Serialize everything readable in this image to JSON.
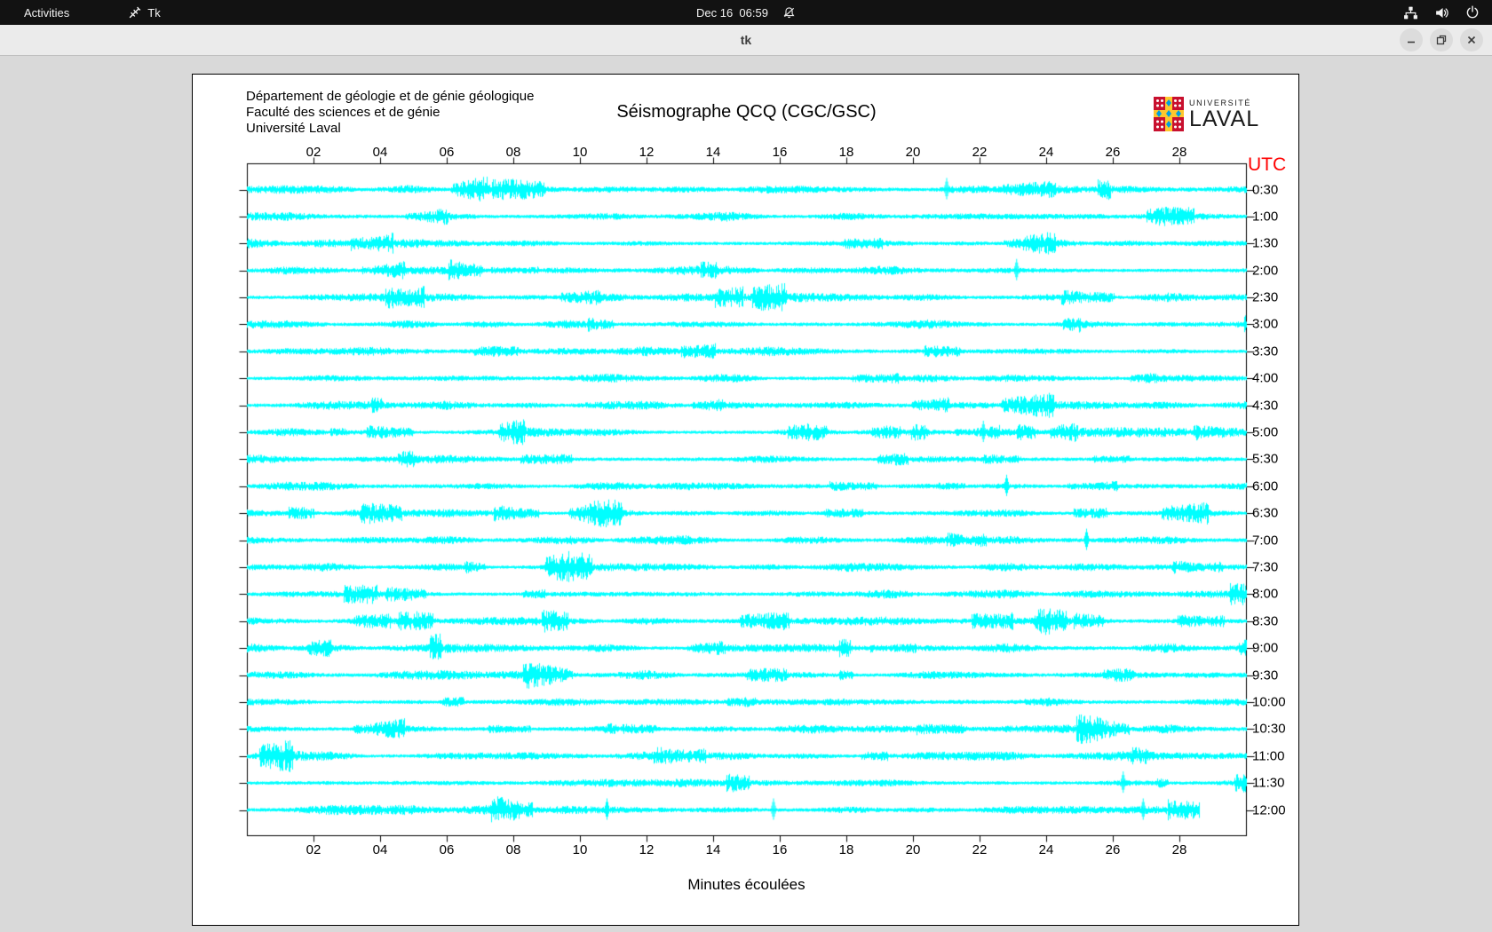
{
  "top_bar": {
    "activities": "Activities",
    "app_indicator": "Tk",
    "clock": "Dec 16  06:59"
  },
  "titlebar": {
    "title": "tk"
  },
  "document": {
    "header_lines": "Département de géologie et de génie géologique\nFaculté des sciences et de génie\nUniversité Laval",
    "logo_top": "UNIVERSITÉ",
    "logo_bottom": "LAVAL"
  },
  "chart_data": {
    "type": "line",
    "title": "Séismographe QCQ (CGC/GSC)",
    "subtitle_right_axis": "UTC",
    "xlabel": "Minutes écoulées",
    "x_range_minutes": [
      0,
      30
    ],
    "x_ticks": [
      "02",
      "04",
      "06",
      "08",
      "10",
      "12",
      "14",
      "16",
      "18",
      "20",
      "22",
      "24",
      "26",
      "28"
    ],
    "n_traces": 24,
    "trace_interval_minutes": 30,
    "trace_labels": [
      "0:30",
      "1:00",
      "1:30",
      "2:00",
      "2:30",
      "3:00",
      "3:30",
      "4:00",
      "4:30",
      "5:00",
      "5:30",
      "6:00",
      "6:30",
      "7:00",
      "7:30",
      "8:00",
      "8:30",
      "9:00",
      "9:30",
      "10:00",
      "10:30",
      "11:00",
      "11:30",
      "12:00"
    ],
    "last_trace_end_minute": 28.6,
    "grid": false,
    "legend": false,
    "colors": {
      "trace": "#00ffff",
      "axis": "#000000",
      "utc_label": "#ff0000",
      "paper": "#ffffff"
    },
    "noise_seed": 9,
    "events": [
      {
        "trace_index": 0,
        "minute": 21.0
      },
      {
        "trace_index": 3,
        "minute": 23.1
      },
      {
        "trace_index": 9,
        "minute": 22.1
      },
      {
        "trace_index": 11,
        "minute": 22.8
      },
      {
        "trace_index": 13,
        "minute": 25.2
      },
      {
        "trace_index": 22,
        "minute": 26.3
      },
      {
        "trace_index": 23,
        "minute": 10.8
      },
      {
        "trace_index": 23,
        "minute": 15.8
      },
      {
        "trace_index": 23,
        "minute": 26.9
      }
    ]
  }
}
